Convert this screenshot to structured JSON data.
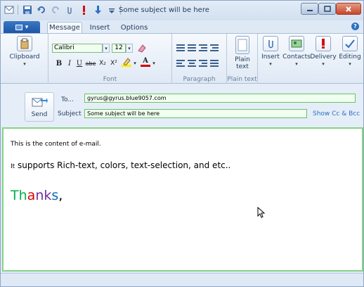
{
  "window": {
    "title": "Some subject will be here"
  },
  "tabs": {
    "file": "",
    "message": "Message",
    "insert": "Insert",
    "options": "Options"
  },
  "ribbon": {
    "clipboard": {
      "button": "Clipboard",
      "group": ""
    },
    "font": {
      "name": "Calibri",
      "size": "12",
      "group": "Font",
      "bold": "B",
      "italic": "I",
      "underline": "U",
      "strike": "abe",
      "subscript": "X₂",
      "superscript": "X²",
      "fontcolor": "A"
    },
    "paragraph": {
      "group": "Paragraph"
    },
    "plain_text": {
      "button_line1": "Plain",
      "button_line2": "text",
      "group": "Plain text"
    },
    "insert": {
      "button": "Insert"
    },
    "contacts": {
      "button": "Contacts"
    },
    "delivery": {
      "button": "Delivery"
    },
    "editing": {
      "button": "Editing"
    }
  },
  "compose": {
    "send": "Send",
    "to_label": "To...",
    "to_value": "gyrus@gyrus.blue9057.com",
    "subject_label": "Subject",
    "subject_value": "Some subject will be here",
    "cc_bcc": "Show Cc & Bcc"
  },
  "body": {
    "line1": "This is the content of e-mail.",
    "line2_prefix": "It",
    "line2_main": " supports Rich-text, colors, text-selection, and etc..",
    "thanks_letters": [
      {
        "ch": "T",
        "color": "#00b050"
      },
      {
        "ch": "h",
        "color": "#00b050"
      },
      {
        "ch": "a",
        "color": "#e00000"
      },
      {
        "ch": "n",
        "color": "#7030a0"
      },
      {
        "ch": "k",
        "color": "#7030a0"
      },
      {
        "ch": "s",
        "color": "#0070c0"
      },
      {
        "ch": ",",
        "color": "#000000"
      }
    ]
  },
  "colors": {
    "accent": "#2c6fc4",
    "field_border": "#68c068",
    "body_border": "#86d486"
  }
}
